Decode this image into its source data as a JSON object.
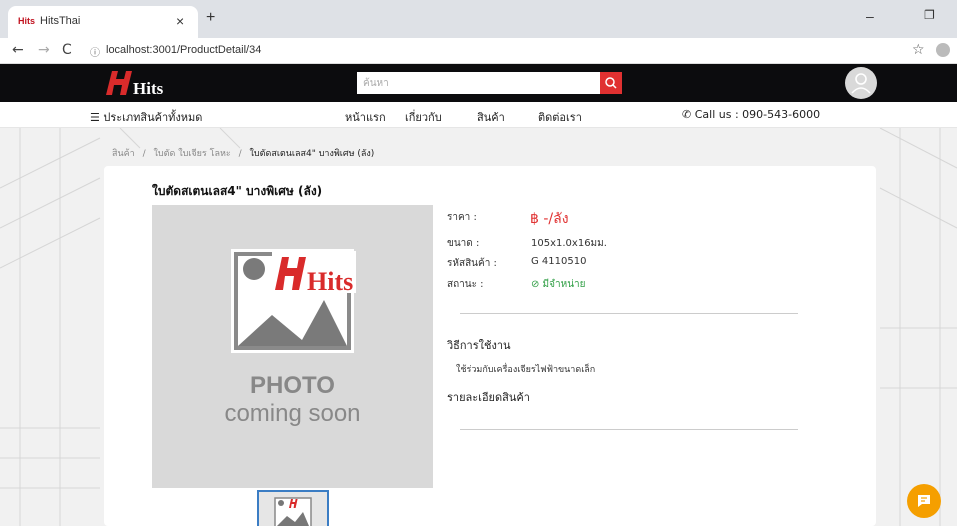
{
  "browser": {
    "tab_title": "HitsThai",
    "favicon_text": "Hits",
    "tab_close": "×",
    "new_tab": "+",
    "url_info": "ⓘ",
    "url": "localhost:3001/ProductDetail/34",
    "back": "←",
    "forward": "→",
    "reload": "C",
    "star": "☆",
    "minimize": "–",
    "restore": "❐"
  },
  "header": {
    "logo_text": "Hits",
    "search_placeholder": "ค้นหา"
  },
  "menu": {
    "all_categories": "☰  ประเภทสินค้าทั้งหมด",
    "items": [
      "หน้าแรก",
      "เกี่ยวกับ",
      "สินค้า",
      "ติดต่อเรา"
    ],
    "call": "✆  Call us : 090-543-6000"
  },
  "breadcrumb": {
    "items": [
      "สินค้า",
      "ใบตัด ใบเจียร โลหะ",
      "ใบตัดสเตนเลส4\" บางพิเศษ (ลัง)"
    ],
    "separator": "/"
  },
  "product": {
    "title": "ใบตัดสเตนเลส4\" บางพิเศษ (ลัง)",
    "photo_line1": "PHOTO",
    "photo_line2": "coming soon",
    "photo_logo_text": "Hits",
    "price_label": "ราคา :",
    "price_value": "฿ -/ลัง",
    "size_label": "ขนาด :",
    "size_value": "105x1.0x16มม.",
    "code_label": "รหัสสินค้า :",
    "code_value": "G 4110510",
    "status_label": "สถานะ :",
    "status_value": "⊘ มีจำหน่าย",
    "usage_title": "วิธีการใช้งาน",
    "usage_text": "ใช้ร่วมกับเครื่องเจียรไฟฟ้าขนาดเล็ก",
    "detail_title": "รายละเอียดสินค้า"
  },
  "colors": {
    "accent_red": "#e03131",
    "status_green": "#2f9e44",
    "header_bg": "#0c0c0e",
    "chat_orange": "#f59f00"
  }
}
